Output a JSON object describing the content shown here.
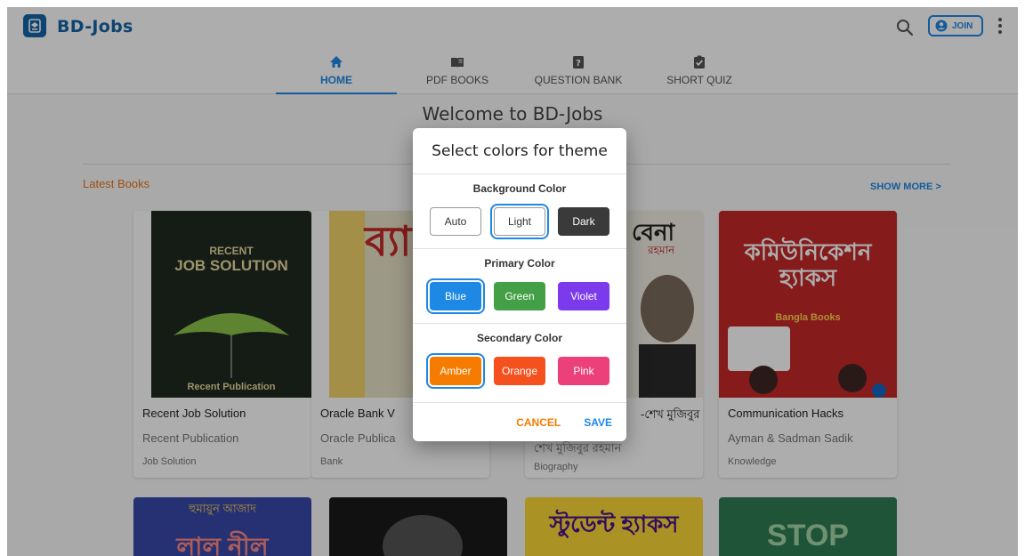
{
  "app": {
    "brand": "BD-Jobs",
    "join_label": "JOIN"
  },
  "tabs": [
    {
      "label": "HOME",
      "icon": "home-icon",
      "active": true
    },
    {
      "label": "PDF BOOKS",
      "icon": "book-icon",
      "active": false
    },
    {
      "label": "QUESTION BANK",
      "icon": "question-icon",
      "active": false
    },
    {
      "label": "SHORT QUIZ",
      "icon": "quiz-icon",
      "active": false
    }
  ],
  "content": {
    "welcome": "Welcome to BD-Jobs",
    "latest_label": "Latest Books",
    "show_more": "SHOW MORE  >"
  },
  "books": [
    {
      "title": "Recent Job Solution",
      "author": "Recent Publication",
      "category": "Job Solution",
      "cover_top": "RECENT",
      "cover_main": "JOB SOLUTION",
      "cover_foot": "Recent Publication"
    },
    {
      "title": "Oracle Bank V",
      "author": "Oracle Publica",
      "category": "Bank",
      "cover_main": "ব্যা ভা"
    },
    {
      "title": "-শেখ মুজিবুর",
      "author": "শেখ মুজিবুর রহমান",
      "category": "Biography",
      "cover_main": "বেনা",
      "cover_sub": "রহমান"
    },
    {
      "title": "Communication Hacks",
      "author": "Ayman & Sadman Sadik",
      "category": "Knowledge",
      "cover_main": "কমিউনিকেশন হ্যাকস",
      "cover_sub": "Bangla Books"
    }
  ],
  "books_row2": [
    {
      "cover_main": "লাল নীল",
      "cover_sub": "হুমায়ুন আজাদ"
    },
    {
      "cover_main": ""
    },
    {
      "cover_main": "স্টুডেন্ট হ্যাকস"
    },
    {
      "cover_main": "STOP"
    }
  ],
  "dialog": {
    "title": "Select colors for theme",
    "background": {
      "label": "Background Color",
      "options": [
        {
          "label": "Auto",
          "color": "#ffffff",
          "selected": false
        },
        {
          "label": "Light",
          "color": "#ffffff",
          "selected": true
        },
        {
          "label": "Dark",
          "color": "#3a3a3a",
          "selected": false
        }
      ]
    },
    "primary": {
      "label": "Primary Color",
      "options": [
        {
          "label": "Blue",
          "color": "#1e88e5",
          "selected": true
        },
        {
          "label": "Green",
          "color": "#43a047",
          "selected": false
        },
        {
          "label": "Violet",
          "color": "#7c3aed",
          "selected": false
        }
      ]
    },
    "secondary": {
      "label": "Secondary Color",
      "options": [
        {
          "label": "Amber",
          "color": "#f57c00",
          "selected": true
        },
        {
          "label": "Orange",
          "color": "#f4511e",
          "selected": false
        },
        {
          "label": "Pink",
          "color": "#ec407a",
          "selected": false
        }
      ]
    },
    "cancel": "CANCEL",
    "save": "SAVE"
  }
}
